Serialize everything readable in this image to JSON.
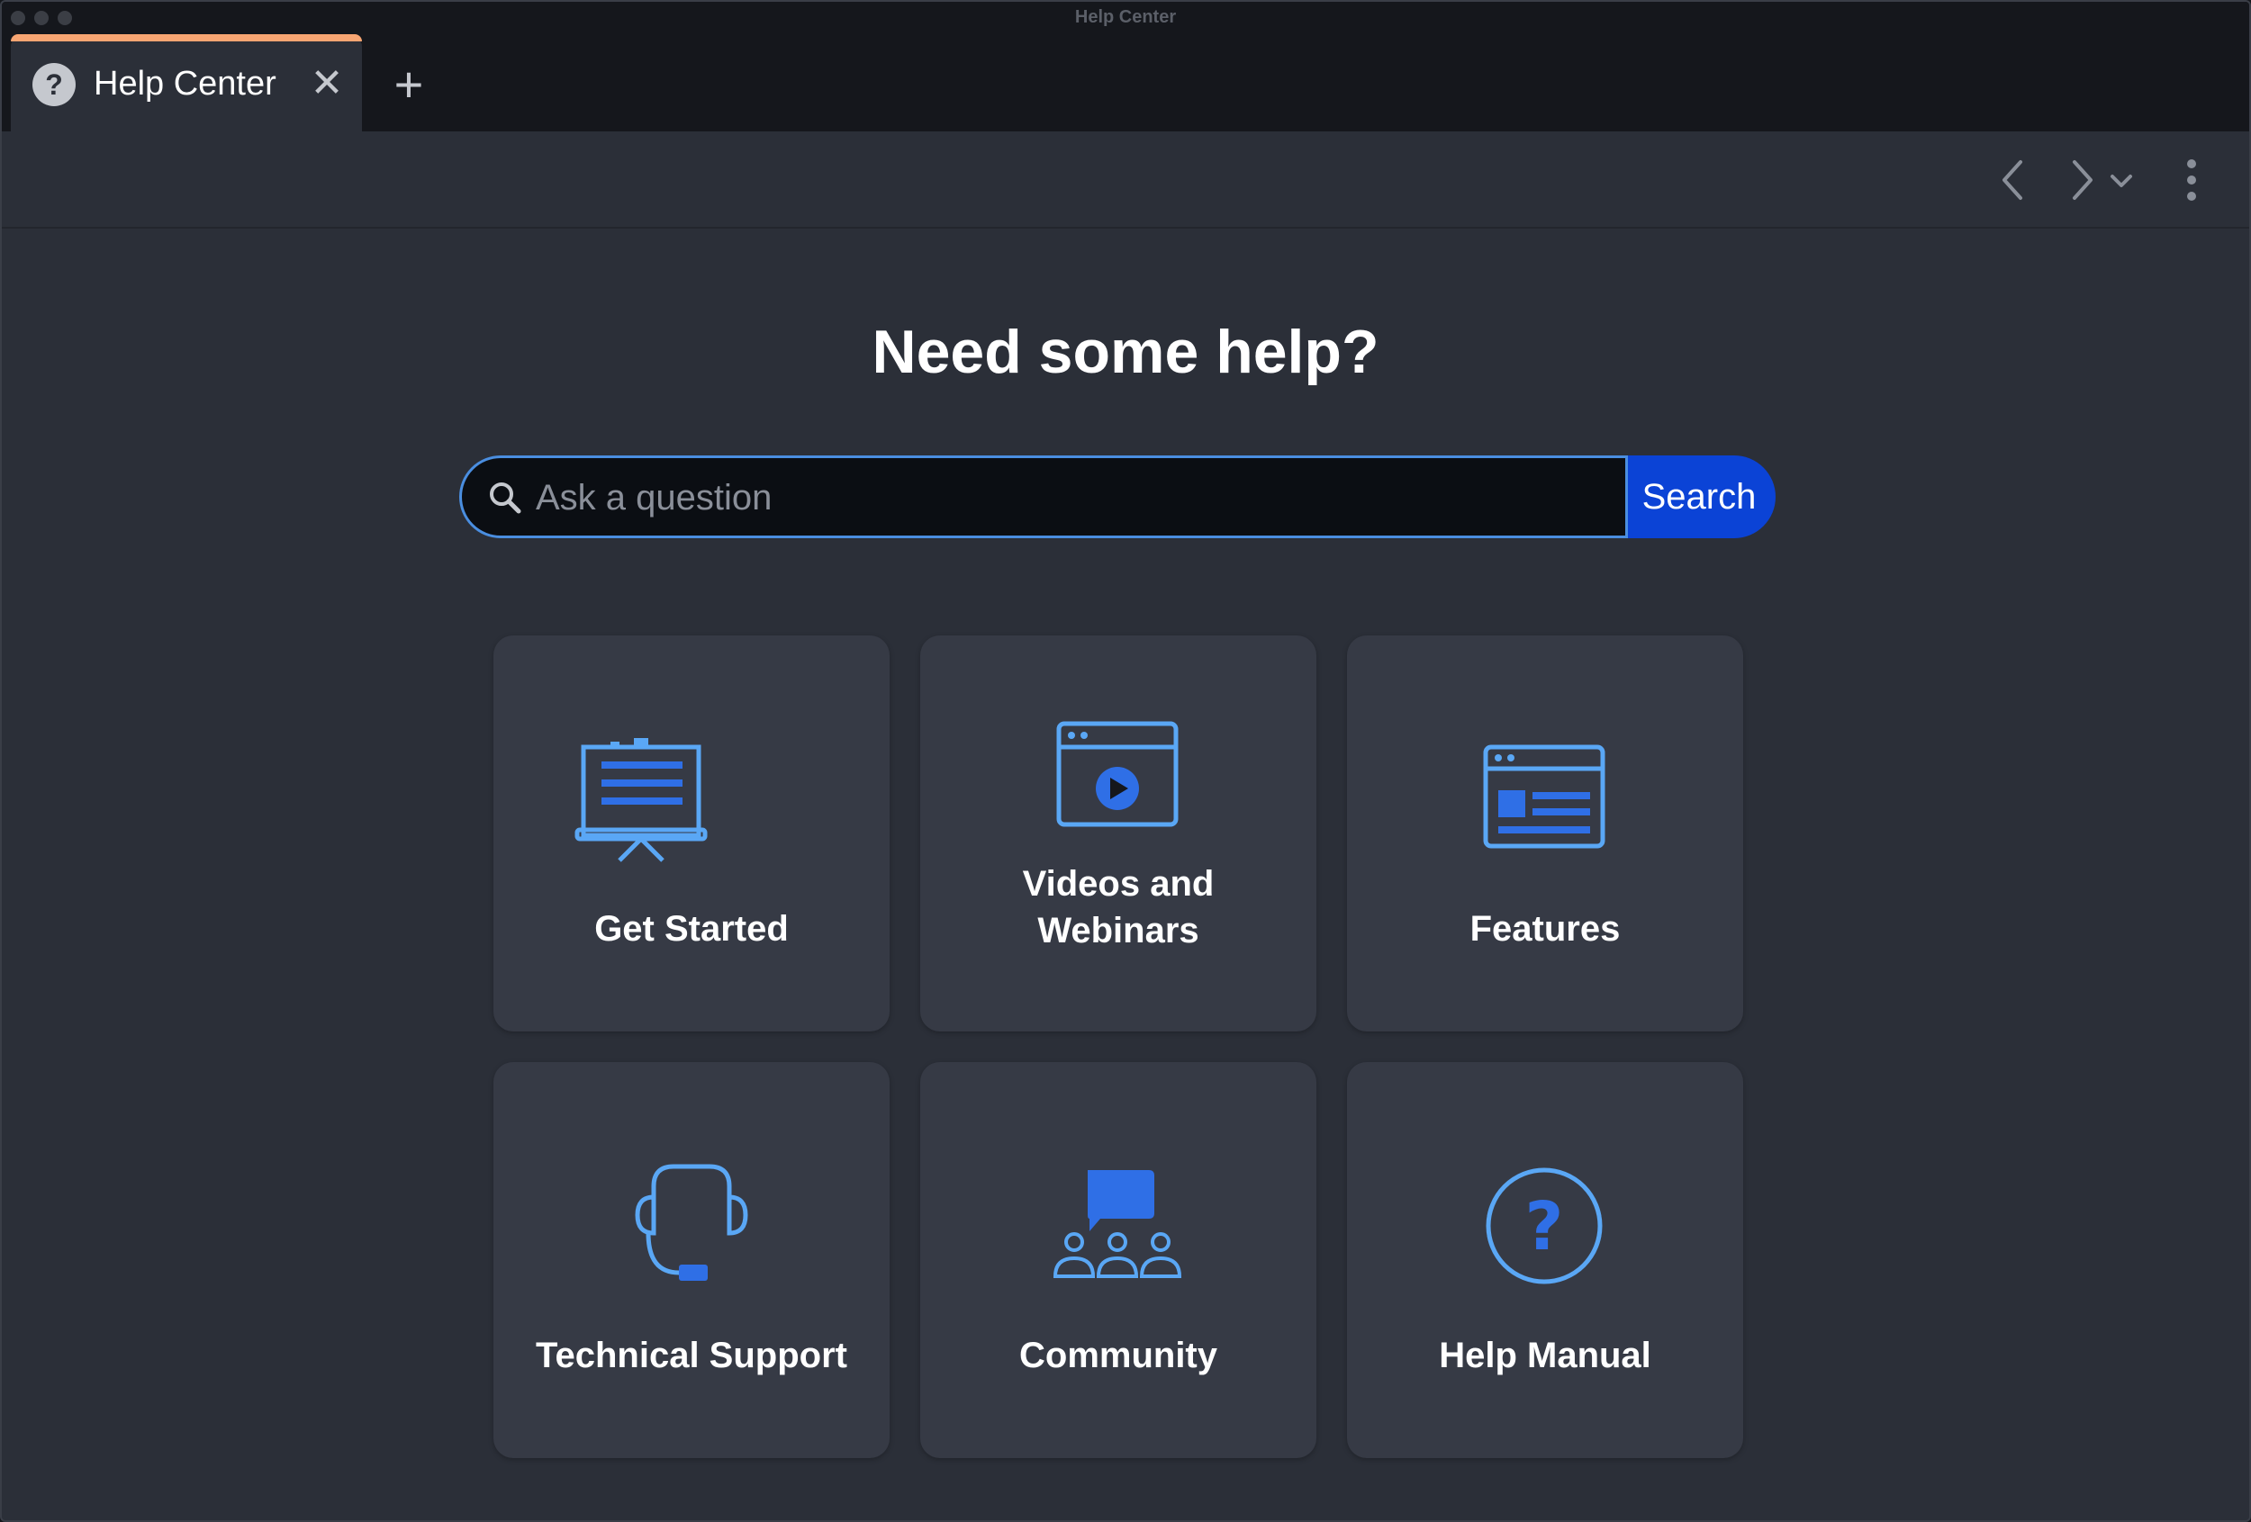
{
  "window": {
    "title": "Help Center"
  },
  "tab": {
    "label": "Help Center",
    "icon": "question-circle-icon",
    "accent_color": "#f7a572"
  },
  "toolbar": {
    "back_icon": "chevron-left-icon",
    "forward_icon": "chevron-right-icon",
    "history_icon": "chevron-down-icon",
    "menu_icon": "vertical-ellipsis-icon"
  },
  "main": {
    "heading": "Need some help?",
    "search": {
      "placeholder": "Ask a question",
      "value": "",
      "button_label": "Search"
    },
    "cards": [
      {
        "label": "Get Started",
        "icon": "presentation-board-icon"
      },
      {
        "label": "Videos and Webinars",
        "icon": "video-window-icon"
      },
      {
        "label": "Features",
        "icon": "browser-layout-icon"
      },
      {
        "label": "Technical Support",
        "icon": "headset-icon"
      },
      {
        "label": "Community",
        "icon": "community-chat-icon"
      },
      {
        "label": "Help Manual",
        "icon": "question-circle-icon"
      }
    ]
  },
  "colors": {
    "accent_blue": "#2f6fe6",
    "icon_light_blue": "#5aa7f5",
    "search_button": "#0b43d6",
    "card_bg": "#363a45",
    "page_bg": "#2b2f38"
  }
}
